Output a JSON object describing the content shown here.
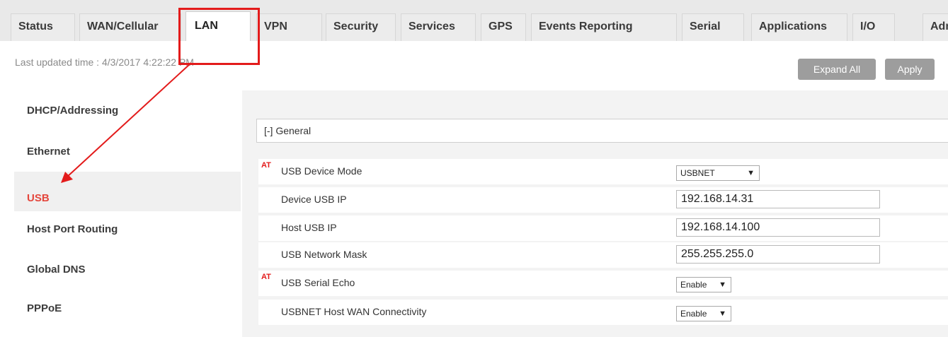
{
  "tabs": [
    {
      "label": "Status"
    },
    {
      "label": "WAN/Cellular"
    },
    {
      "label": "LAN"
    },
    {
      "label": "VPN"
    },
    {
      "label": "Security"
    },
    {
      "label": "Services"
    },
    {
      "label": "GPS"
    },
    {
      "label": "Events Reporting"
    },
    {
      "label": "Serial"
    },
    {
      "label": "Applications"
    },
    {
      "label": "I/O"
    },
    {
      "label": "Admin"
    }
  ],
  "header": {
    "last_updated": "Last updated time : 4/3/2017 4:22:22 PM",
    "expand_all_label": "Expand All",
    "apply_label": "Apply"
  },
  "sidebar": {
    "items": [
      {
        "label": "DHCP/Addressing"
      },
      {
        "label": "Ethernet"
      },
      {
        "label": "USB"
      },
      {
        "label": "Host Port Routing"
      },
      {
        "label": "Global DNS"
      },
      {
        "label": "PPPoE"
      }
    ]
  },
  "section": {
    "title": "[-] General"
  },
  "rows": [
    {
      "flag": "AT",
      "label": "USB Device Mode",
      "value": "USBNET"
    },
    {
      "flag": "",
      "label": "Device USB IP",
      "value": "192.168.14.31"
    },
    {
      "flag": "",
      "label": "Host USB IP",
      "value": "192.168.14.100"
    },
    {
      "flag": "",
      "label": "USB Network Mask",
      "value": "255.255.255.0"
    },
    {
      "flag": "AT",
      "label": "USB Serial Echo",
      "value": "Enable"
    },
    {
      "flag": "",
      "label": "USBNET Host WAN Connectivity",
      "value": "Enable"
    }
  ],
  "icons": {
    "dropdown": "caret-down-icon"
  },
  "colors": {
    "highlight": "#e31b1b",
    "active_nav": "#e4463c",
    "button": "#9d9d9d"
  }
}
